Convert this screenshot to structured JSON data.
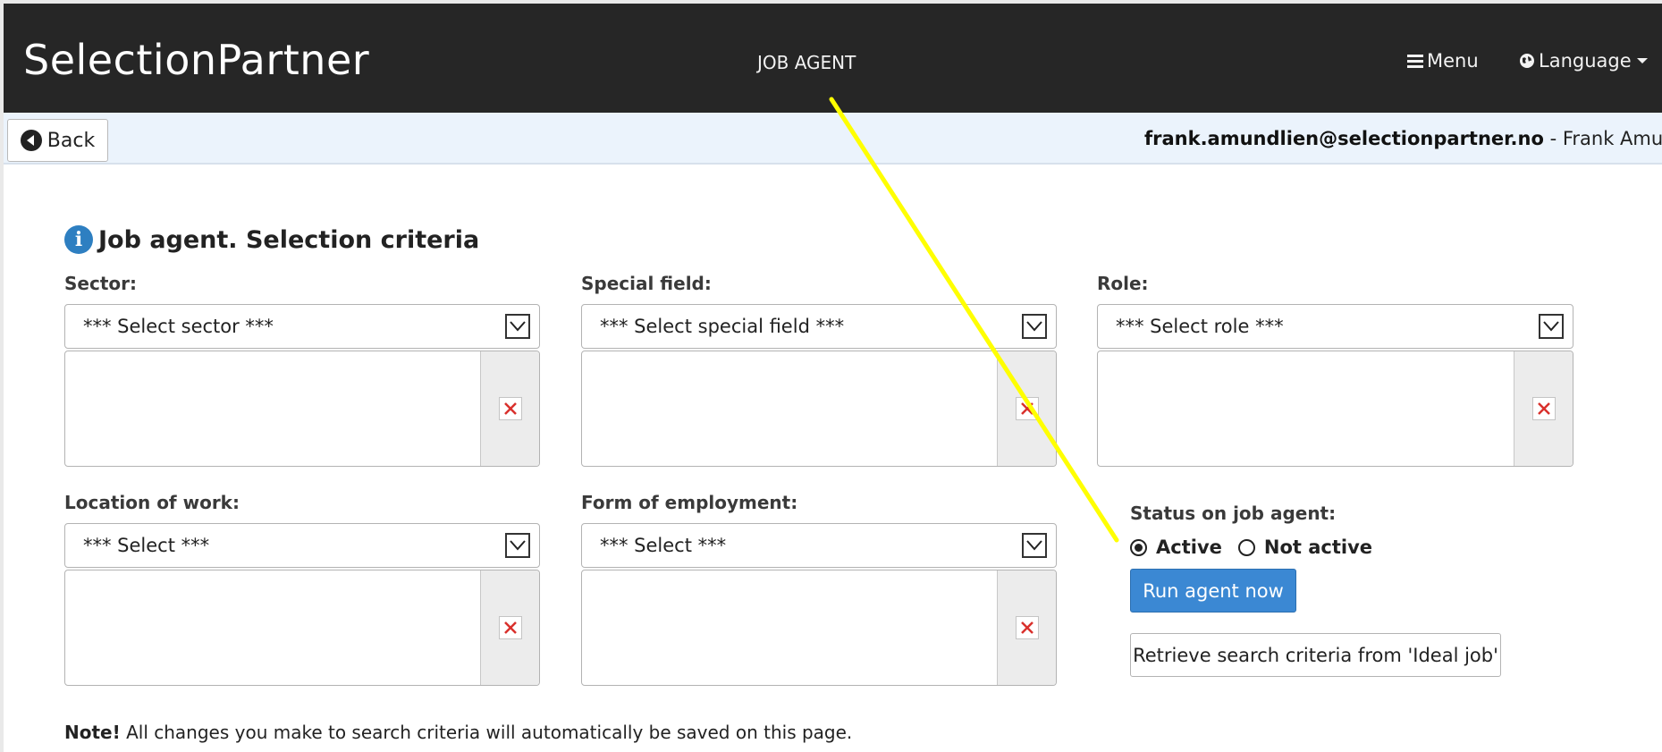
{
  "header": {
    "brand": "SelectionPartner",
    "title": "JOB AGENT",
    "menu_label": "Menu",
    "language_label": "Language"
  },
  "subbar": {
    "back_label": "Back",
    "user_email": "frank.amundlien@selectionpartner.no",
    "user_separator": " - ",
    "user_name": "Frank Amundlien"
  },
  "main": {
    "heading": "Job agent. Selection criteria",
    "sector": {
      "label": "Sector:",
      "select": "*** Select sector ***"
    },
    "special_field": {
      "label": "Special field:",
      "select": "*** Select special field ***"
    },
    "role": {
      "label": "Role:",
      "select": "*** Select role ***"
    },
    "location": {
      "label": "Location of work:",
      "select": "*** Select ***"
    },
    "employment": {
      "label": "Form of employment:",
      "select": "*** Select ***"
    },
    "status": {
      "label": "Status on job agent:",
      "active_label": "Active",
      "inactive_label": "Not active",
      "selected": "Active"
    },
    "run_button": "Run agent now",
    "retrieve_button": "Retrieve search criteria from 'Ideal job'",
    "note_bold": "Note!",
    "note_text": " All changes you make to search criteria will automatically be saved on this page."
  },
  "colors": {
    "navbar": "#262626",
    "subbar": "#ebf3fc",
    "primary_button": "#3b88d3",
    "delete_icon": "#d9302c",
    "annotation": "#ffff00"
  }
}
